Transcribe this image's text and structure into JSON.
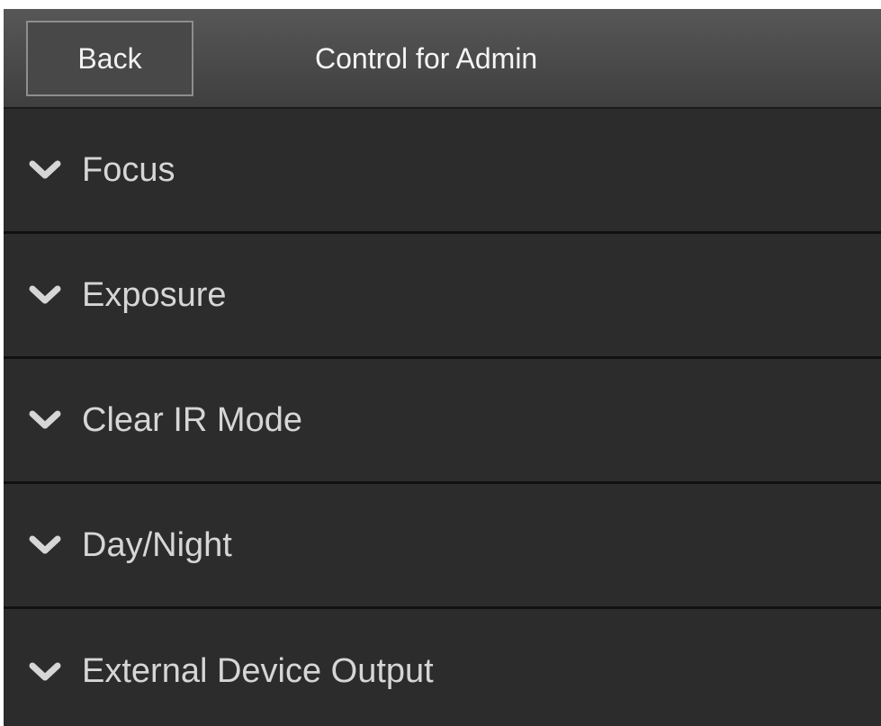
{
  "header": {
    "back_label": "Back",
    "title": "Control for Admin"
  },
  "sections": [
    {
      "label": "Focus",
      "icon": "chevron-down-icon"
    },
    {
      "label": "Exposure",
      "icon": "chevron-down-icon"
    },
    {
      "label": "Clear IR Mode",
      "icon": "chevron-down-icon"
    },
    {
      "label": "Day/Night",
      "icon": "chevron-down-icon"
    },
    {
      "label": "External Device Output",
      "icon": "chevron-down-icon"
    }
  ],
  "colors": {
    "background": "#2b2b2b",
    "header": "#4a4a4a",
    "text": "#d6d6d6",
    "divider": "#111111"
  }
}
